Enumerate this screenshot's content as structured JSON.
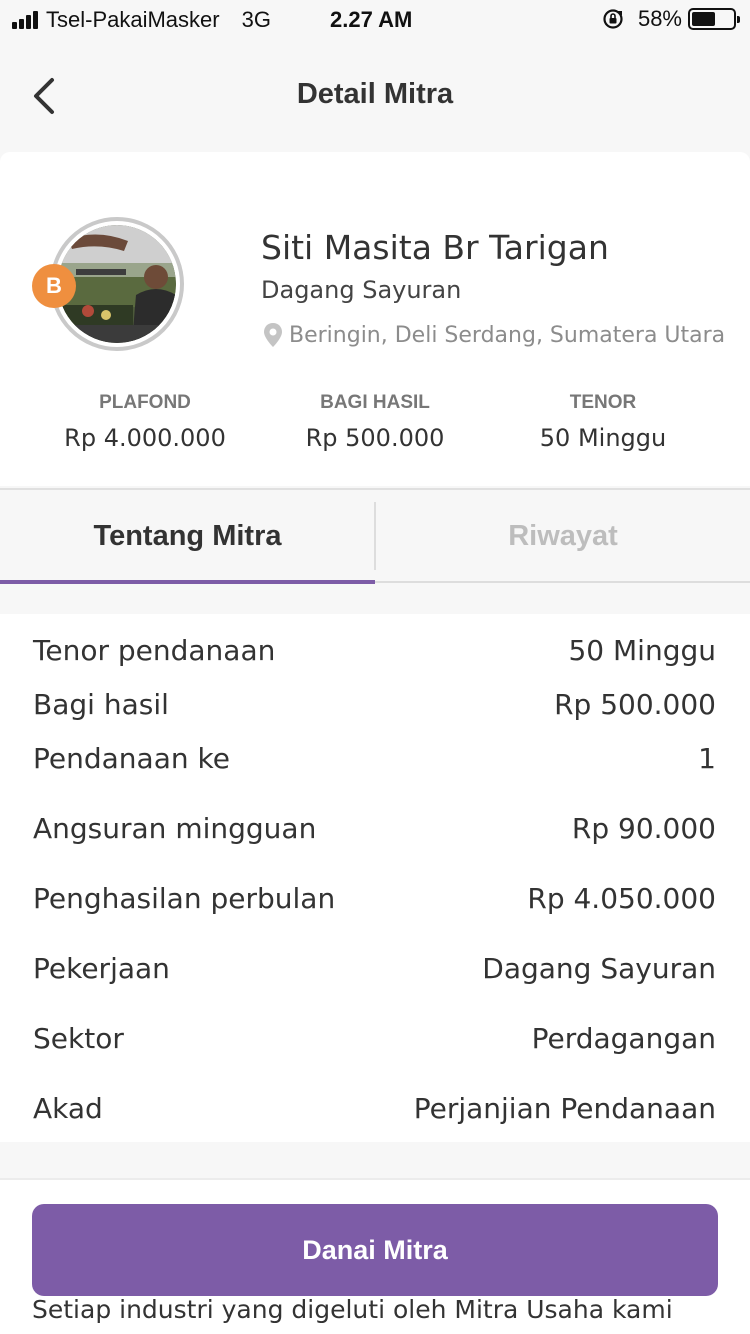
{
  "status_bar": {
    "carrier": "Tsel-PakaiMasker",
    "network": "3G",
    "time": "2.27 AM",
    "battery": "58%",
    "battery_level": 0.58
  },
  "nav": {
    "title": "Detail Mitra",
    "back_icon": "chevron-left-icon"
  },
  "profile": {
    "badge": "B",
    "name": "Siti Masita Br Tarigan",
    "occupation": "Dagang Sayuran",
    "location": "Beringin, Deli Serdang, Sumatera Utara",
    "stats": [
      {
        "label": "PLAFOND",
        "value": "Rp 4.000.000"
      },
      {
        "label": "BAGI HASIL",
        "value": "Rp 500.000"
      },
      {
        "label": "TENOR",
        "value": "50 Minggu"
      }
    ]
  },
  "tabs": [
    {
      "label": "Tentang Mitra",
      "active": true
    },
    {
      "label": "Riwayat",
      "active": false
    }
  ],
  "details": [
    {
      "key": "Tenor pendanaan",
      "value": "50 Minggu"
    },
    {
      "key": "Bagi hasil",
      "value": "Rp 500.000"
    },
    {
      "key": "Pendanaan ke",
      "value": "1"
    },
    {
      "key": "Angsuran mingguan",
      "value": "Rp 90.000"
    },
    {
      "key": "Penghasilan perbulan",
      "value": "Rp 4.050.000"
    },
    {
      "key": "Pekerjaan",
      "value": "Dagang Sayuran"
    },
    {
      "key": "Sektor",
      "value": "Perdagangan"
    },
    {
      "key": "Akad",
      "value": "Perjanjian Pendanaan"
    }
  ],
  "cta": {
    "label": "Danai Mitra"
  },
  "footnote": "Setiap industri yang digeluti oleh Mitra Usaha kami",
  "colors": {
    "accent": "#7d5ca7",
    "badge": "#ef8f3f"
  }
}
